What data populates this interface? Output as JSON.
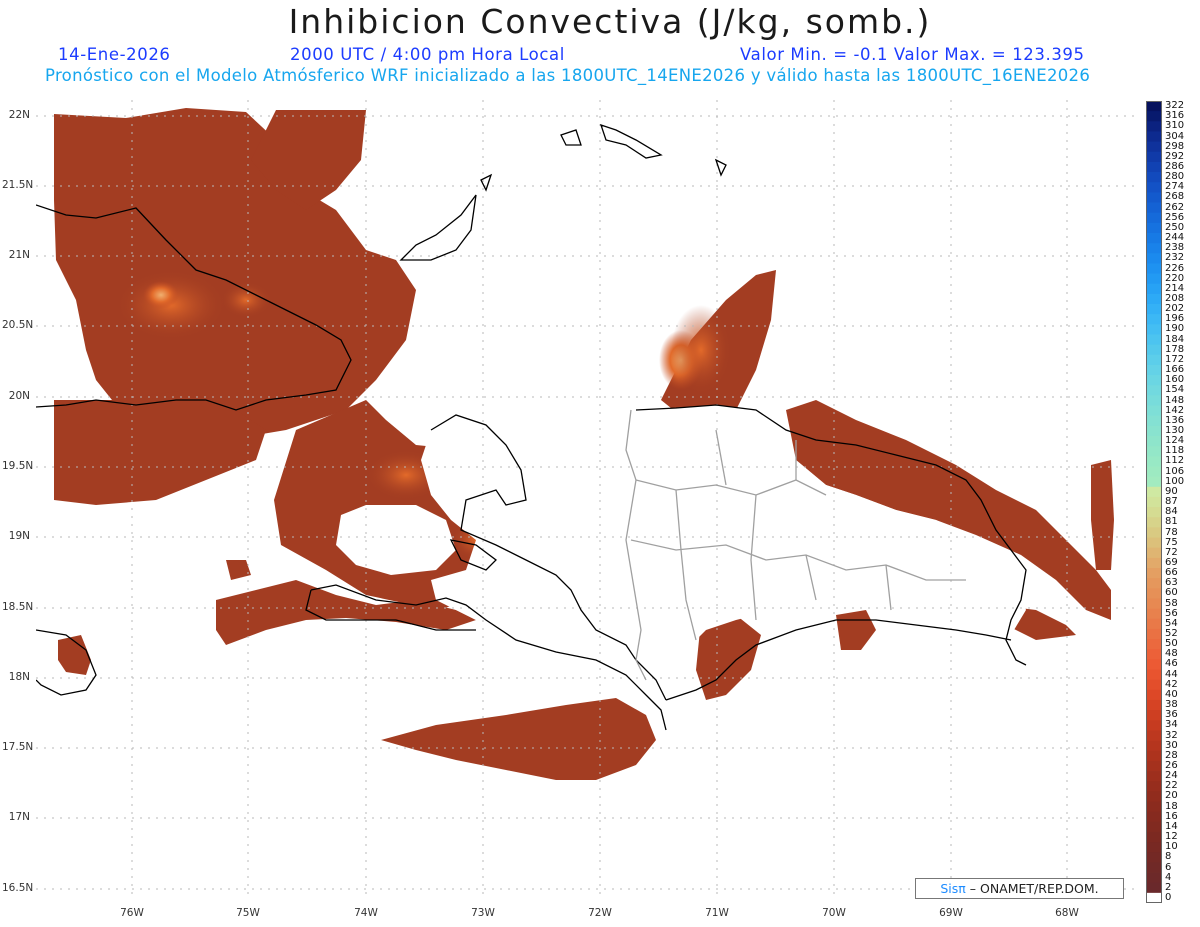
{
  "header": {
    "title": "Inhibicion Convectiva (J/kg, somb.)",
    "date": "14-Ene-2026",
    "time": "2000 UTC / 4:00 pm Hora Local",
    "minmax": "Valor Min. = -0.1  Valor Max. = 123.395",
    "forecast": "Pronóstico con el Modelo Atmósferico WRF inicializado a las 1800UTC_14ENE2026 y válido hasta las  1800UTC_16ENE2026"
  },
  "map": {
    "lat_labels": [
      "22N",
      "21.5N",
      "21N",
      "20.5N",
      "20N",
      "19.5N",
      "19N",
      "18.5N",
      "18N",
      "17.5N",
      "17N",
      "16.5N"
    ],
    "lon_labels": [
      "76W",
      "75W",
      "74W",
      "73W",
      "72W",
      "71W",
      "70W",
      "69W",
      "68W"
    ],
    "field_color": "#a33d22",
    "field_color_high": "#e06a28",
    "land_fill": "#ffffff",
    "coast_color": "#000000",
    "border_color": "#a0a0a0"
  },
  "colorbar": {
    "labels": [
      "322",
      "316",
      "310",
      "304",
      "298",
      "292",
      "286",
      "280",
      "274",
      "268",
      "262",
      "256",
      "250",
      "244",
      "238",
      "232",
      "226",
      "220",
      "214",
      "208",
      "202",
      "196",
      "190",
      "184",
      "178",
      "172",
      "166",
      "160",
      "154",
      "148",
      "142",
      "136",
      "130",
      "124",
      "118",
      "112",
      "106",
      "100",
      "90",
      "87",
      "84",
      "81",
      "78",
      "75",
      "72",
      "69",
      "66",
      "63",
      "60",
      "58",
      "56",
      "54",
      "52",
      "50",
      "48",
      "46",
      "44",
      "42",
      "40",
      "38",
      "36",
      "34",
      "32",
      "30",
      "28",
      "26",
      "24",
      "22",
      "20",
      "18",
      "16",
      "14",
      "12",
      "10",
      "8",
      "6",
      "4",
      "2",
      "0"
    ],
    "colors": [
      "#06125e",
      "#081a6e",
      "#0b2280",
      "#0d2a8f",
      "#0f329c",
      "#103aa8",
      "#1142b3",
      "#124abd",
      "#1352c6",
      "#135acd",
      "#1462d4",
      "#156ada",
      "#1672e0",
      "#177ae5",
      "#1982ea",
      "#1b8aee",
      "#1e92f1",
      "#229af3",
      "#27a2f5",
      "#2daaf6",
      "#34b1f6",
      "#3cb8f5",
      "#44bef3",
      "#4cc4f0",
      "#54c9ec",
      "#5cceea",
      "#64d2e7",
      "#6bd6e3",
      "#72d9df",
      "#78dcdb",
      "#7edfd7",
      "#84e1d3",
      "#89e3cf",
      "#8ee5cb",
      "#93e7c8",
      "#98e9c5",
      "#9deac2",
      "#a2ebc0",
      "#cfe9a2",
      "#d2e39a",
      "#d5dc92",
      "#d7d38a",
      "#d9ca82",
      "#dcc07a",
      "#dfb572",
      "#e2aa6a",
      "#e49f62",
      "#e5975c",
      "#e69057",
      "#e78952",
      "#e8814d",
      "#e97948",
      "#ea7143",
      "#eb693e",
      "#ec6139",
      "#ec5a34",
      "#e8542f",
      "#e34e2b",
      "#dd4827",
      "#d64324",
      "#ce3f22",
      "#c63b20",
      "#bd381f",
      "#b5351e",
      "#ad331d",
      "#a5311d",
      "#9e2f1d",
      "#972d1d",
      "#912c1d",
      "#8b2b1e",
      "#862a1f",
      "#812a20",
      "#7c2921",
      "#782923",
      "#742925",
      "#702927",
      "#6d2929",
      "#6a292b",
      "#ffffff"
    ]
  },
  "credit": {
    "sis": "Sisπ",
    "rest": " – ONAMET/REP.DOM."
  }
}
